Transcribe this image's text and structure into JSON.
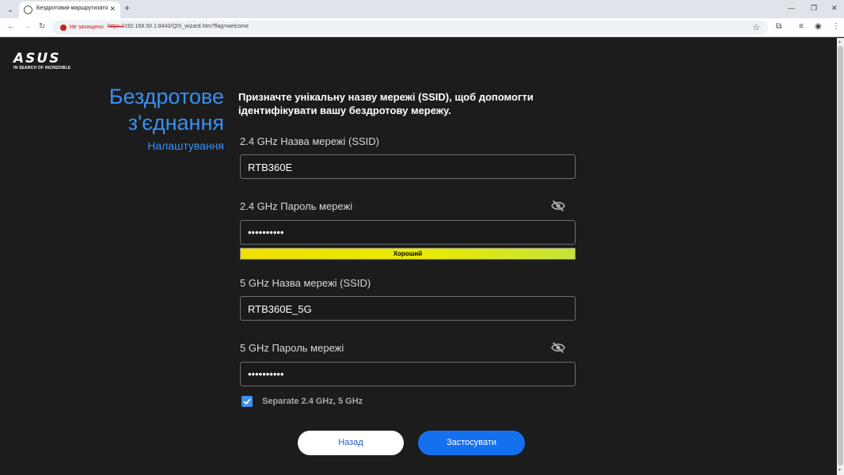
{
  "browser": {
    "tab_title": "Бездротовий маршрутизатор A",
    "insecure_label": "Не захищено",
    "url_protocol": "https://",
    "url_rest": "192.168.50.1:8443/QIS_wizard.htm?flag=welcome"
  },
  "brand": {
    "logo_text": "ASUS",
    "tagline": "IN SEARCH OF INCREDIBLE"
  },
  "heading": {
    "title": "Бездротове\nз'єднання",
    "subtitle": "Налаштування"
  },
  "description": "Призначте унікальну назву мережі (SSID), щоб допомогти ідентифікувати вашу бездротову мережу.",
  "fields": {
    "ssid_24_label": "2.4 GHz Назва мережі (SSID)",
    "ssid_24_value": "RTB360E",
    "pass_24_label": "2.4 GHz Пароль мережі",
    "pass_24_value": "••••••••••",
    "strength_label": "Хороший",
    "ssid_5_label": "5 GHz Назва мережі (SSID)",
    "ssid_5_value": "RTB360E_5G",
    "pass_5_label": "5 GHz Пароль мережі",
    "pass_5_value": "••••••••••"
  },
  "separate": {
    "checked": true,
    "label": "Separate 2.4 GHz, 5 GHz"
  },
  "buttons": {
    "back": "Назад",
    "apply": "Застосувати"
  },
  "colors": {
    "accent": "#3b8ff2",
    "button_primary": "#1570ef",
    "background": "#1c1c1c",
    "insecure": "#c5221f"
  }
}
